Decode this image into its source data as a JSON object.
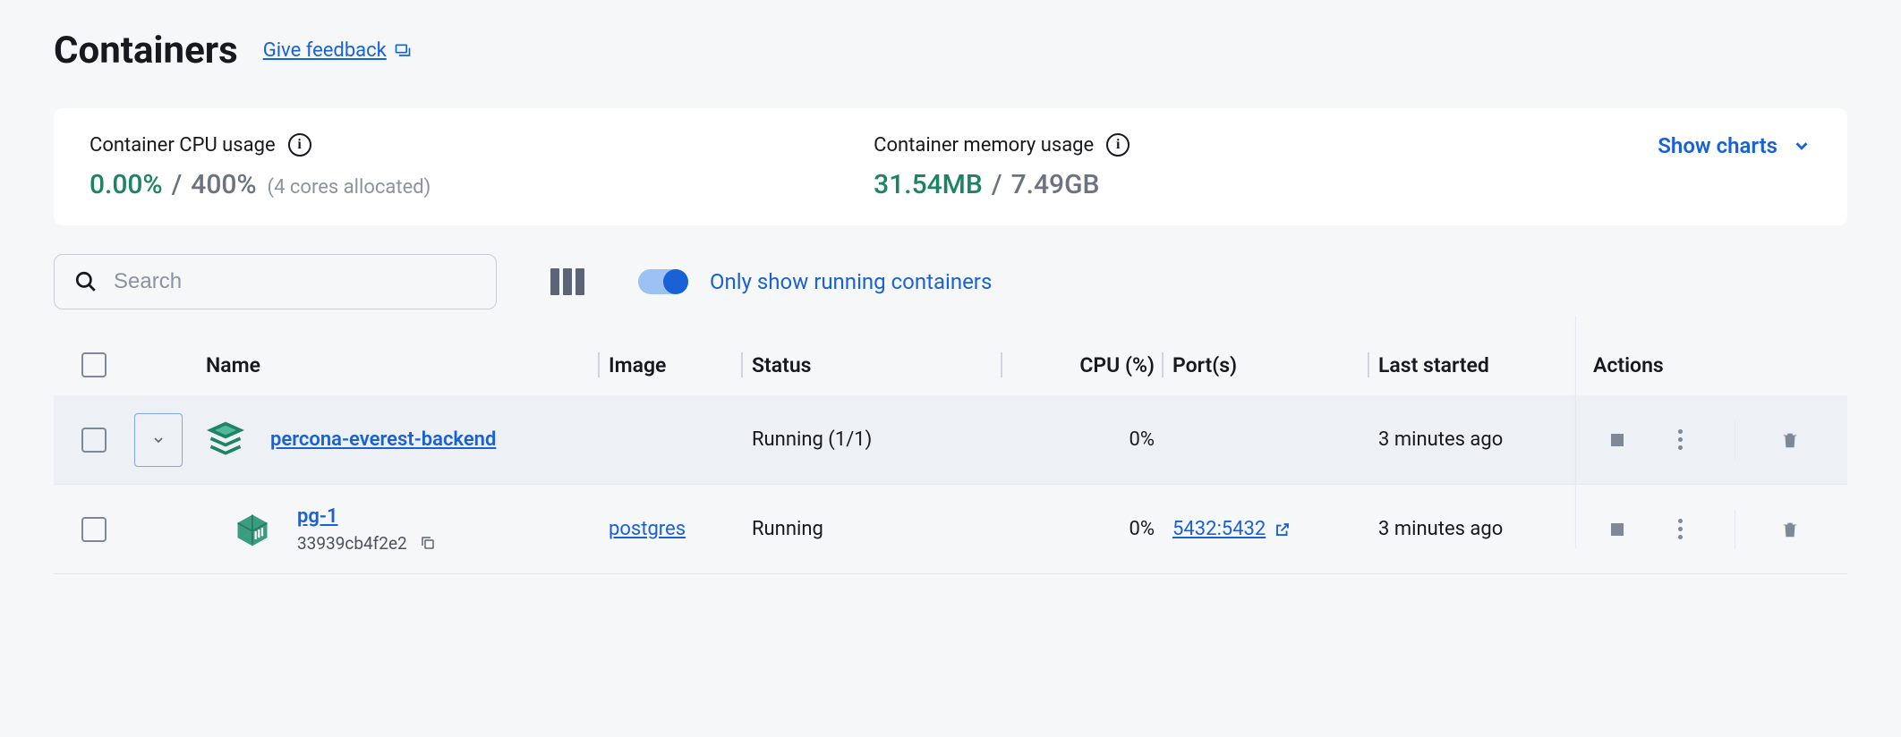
{
  "header": {
    "title": "Containers",
    "feedback_label": "Give feedback"
  },
  "stats": {
    "cpu": {
      "label": "Container CPU usage",
      "used": "0.00%",
      "total": "400%",
      "note": "(4 cores allocated)"
    },
    "memory": {
      "label": "Container memory usage",
      "used": "31.54MB",
      "total": "7.49GB"
    },
    "show_charts": "Show charts"
  },
  "toolbar": {
    "search_placeholder": "Search",
    "toggle_label": "Only show running containers"
  },
  "table": {
    "headers": {
      "name": "Name",
      "image": "Image",
      "status": "Status",
      "cpu": "CPU (%)",
      "ports": "Port(s)",
      "started": "Last started",
      "actions": "Actions"
    },
    "rows": [
      {
        "name": "percona-everest-backend",
        "image": "",
        "status": "Running (1/1)",
        "cpu": "0%",
        "ports": "",
        "started": "3 minutes ago",
        "is_group": true
      },
      {
        "name": "pg-1",
        "container_id": "33939cb4f2e2",
        "image": "postgres",
        "status": "Running",
        "cpu": "0%",
        "ports": "5432:5432",
        "started": "3 minutes ago",
        "is_group": false
      }
    ]
  }
}
